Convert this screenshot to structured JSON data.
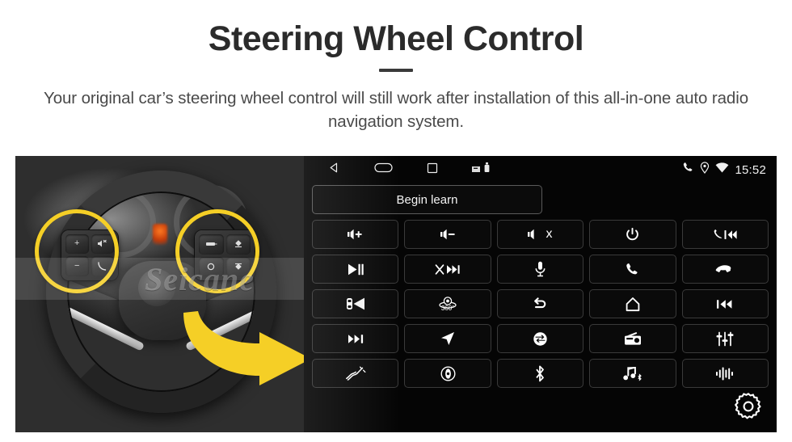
{
  "header": {
    "title": "Steering Wheel Control",
    "subtitle": "Your original car’s steering wheel control will still work after installation of this all-in-one auto radio navigation system."
  },
  "photo": {
    "watermark": "Seicane",
    "highlight_color": "#f5cf26",
    "arrow_color": "#f5cf26",
    "left_pod_keys": [
      "volume-up",
      "mute",
      "volume-down",
      "phone-call"
    ],
    "right_pod_keys": [
      "cruise-set",
      "cruise-up",
      "cruise-resume",
      "cruise-down"
    ]
  },
  "android": {
    "statusbar": {
      "nav": [
        "back-icon",
        "home-icon",
        "recents-icon",
        "sdcard-icon",
        "usb-icon"
      ],
      "system": [
        "phone-icon",
        "location-icon",
        "wifi-icon"
      ],
      "clock": "15:52"
    },
    "learn_button": {
      "label": "Begin learn"
    },
    "settings_icon": "gear-icon",
    "buttons": [
      {
        "icon": "volume-up-icon",
        "label": "+",
        "name": "btn-volume-up"
      },
      {
        "icon": "volume-down-icon",
        "label": "−",
        "name": "btn-volume-down"
      },
      {
        "icon": "volume-mute-icon",
        "label": "x",
        "name": "btn-mute"
      },
      {
        "icon": "power-icon",
        "label": "",
        "name": "btn-power"
      },
      {
        "icon": "phone-prev-icon",
        "label": "",
        "name": "btn-call-previous"
      },
      {
        "icon": "play-pause-icon",
        "label": "",
        "name": "btn-play-pause"
      },
      {
        "icon": "shuffle-next-icon",
        "label": "",
        "name": "btn-shuffle-next"
      },
      {
        "icon": "mic-icon",
        "label": "",
        "name": "btn-voice"
      },
      {
        "icon": "phone-answer-icon",
        "label": "",
        "name": "btn-answer-call"
      },
      {
        "icon": "phone-hangup-icon",
        "label": "",
        "name": "btn-hangup-call"
      },
      {
        "icon": "rear-camera-icon",
        "label": "",
        "name": "btn-rear-camera"
      },
      {
        "icon": "camera-360-icon",
        "label": "360°",
        "name": "btn-camera-360"
      },
      {
        "icon": "back-arrow-icon",
        "label": "",
        "name": "btn-back"
      },
      {
        "icon": "home-house-icon",
        "label": "",
        "name": "btn-home"
      },
      {
        "icon": "track-previous-icon",
        "label": "",
        "name": "btn-previous-track"
      },
      {
        "icon": "track-next-icon",
        "label": "",
        "name": "btn-next-track"
      },
      {
        "icon": "navigation-icon",
        "label": "",
        "name": "btn-navigation"
      },
      {
        "icon": "source-switch-icon",
        "label": "",
        "name": "btn-source-switch"
      },
      {
        "icon": "radio-icon",
        "label": "",
        "name": "btn-radio"
      },
      {
        "icon": "equalizer-icon",
        "label": "",
        "name": "btn-equalizer"
      },
      {
        "icon": "aux-cable-icon",
        "label": "",
        "name": "btn-aux"
      },
      {
        "icon": "dvd-disc-icon",
        "label": "",
        "name": "btn-dvd"
      },
      {
        "icon": "bluetooth-icon",
        "label": "",
        "name": "btn-bluetooth"
      },
      {
        "icon": "bt-music-icon",
        "label": "",
        "name": "btn-bluetooth-music"
      },
      {
        "icon": "sound-wave-icon",
        "label": "",
        "name": "btn-sound-effect"
      }
    ]
  }
}
